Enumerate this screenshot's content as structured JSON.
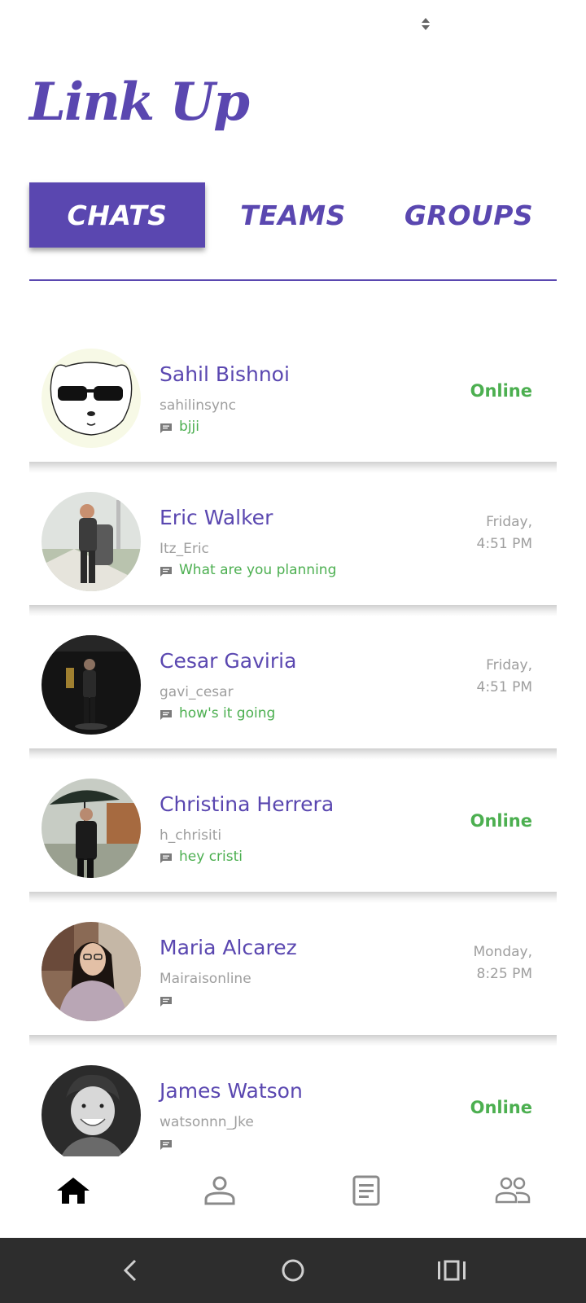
{
  "app": {
    "title": "Link Up"
  },
  "tabs": [
    {
      "label": "CHATS",
      "active": true
    },
    {
      "label": "TEAMS",
      "active": false
    },
    {
      "label": "GROUPS",
      "active": false
    }
  ],
  "chats": [
    {
      "name": "Sahil Bishnoi",
      "username": "sahilinsync",
      "last_message": "bjji",
      "status": "Online",
      "time": ""
    },
    {
      "name": "Eric Walker",
      "username": "Itz_Eric",
      "last_message": "What are you planning",
      "status": "",
      "time_day": "Friday,",
      "time_clock": "4:51 PM"
    },
    {
      "name": "Cesar Gaviria",
      "username": "gavi_cesar",
      "last_message": "how's it going",
      "status": "",
      "time_day": "Friday,",
      "time_clock": "4:51 PM"
    },
    {
      "name": "Christina Herrera",
      "username": "h_chrisiti",
      "last_message": "hey cristi",
      "status": "Online",
      "time": ""
    },
    {
      "name": "Maria Alcarez",
      "username": "Mairaisonline",
      "last_message": "",
      "status": "",
      "time_day": "Monday,",
      "time_clock": "8:25 PM"
    },
    {
      "name": "James Watson",
      "username": "watsonnn_Jke",
      "last_message": "",
      "status": "Online",
      "time": ""
    }
  ],
  "bottom_nav": [
    {
      "icon": "home-icon",
      "active": true
    },
    {
      "icon": "profile-icon",
      "active": false
    },
    {
      "icon": "notes-icon",
      "active": false
    },
    {
      "icon": "people-icon",
      "active": false
    }
  ],
  "colors": {
    "accent": "#5a47b0",
    "online": "#4caf50",
    "muted": "#9e9e9e"
  }
}
